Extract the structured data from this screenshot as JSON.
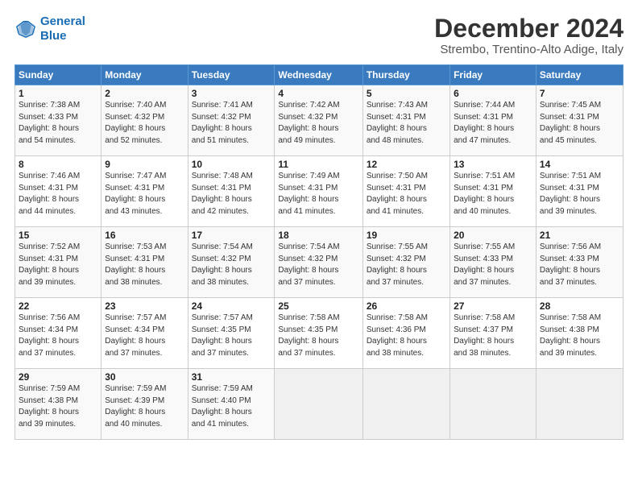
{
  "header": {
    "logo_line1": "General",
    "logo_line2": "Blue",
    "title": "December 2024",
    "subtitle": "Strembo, Trentino-Alto Adige, Italy"
  },
  "calendar": {
    "weekdays": [
      "Sunday",
      "Monday",
      "Tuesday",
      "Wednesday",
      "Thursday",
      "Friday",
      "Saturday"
    ],
    "weeks": [
      [
        {
          "day": "1",
          "info": "Sunrise: 7:38 AM\nSunset: 4:33 PM\nDaylight: 8 hours\nand 54 minutes."
        },
        {
          "day": "2",
          "info": "Sunrise: 7:40 AM\nSunset: 4:32 PM\nDaylight: 8 hours\nand 52 minutes."
        },
        {
          "day": "3",
          "info": "Sunrise: 7:41 AM\nSunset: 4:32 PM\nDaylight: 8 hours\nand 51 minutes."
        },
        {
          "day": "4",
          "info": "Sunrise: 7:42 AM\nSunset: 4:32 PM\nDaylight: 8 hours\nand 49 minutes."
        },
        {
          "day": "5",
          "info": "Sunrise: 7:43 AM\nSunset: 4:31 PM\nDaylight: 8 hours\nand 48 minutes."
        },
        {
          "day": "6",
          "info": "Sunrise: 7:44 AM\nSunset: 4:31 PM\nDaylight: 8 hours\nand 47 minutes."
        },
        {
          "day": "7",
          "info": "Sunrise: 7:45 AM\nSunset: 4:31 PM\nDaylight: 8 hours\nand 45 minutes."
        }
      ],
      [
        {
          "day": "8",
          "info": "Sunrise: 7:46 AM\nSunset: 4:31 PM\nDaylight: 8 hours\nand 44 minutes."
        },
        {
          "day": "9",
          "info": "Sunrise: 7:47 AM\nSunset: 4:31 PM\nDaylight: 8 hours\nand 43 minutes."
        },
        {
          "day": "10",
          "info": "Sunrise: 7:48 AM\nSunset: 4:31 PM\nDaylight: 8 hours\nand 42 minutes."
        },
        {
          "day": "11",
          "info": "Sunrise: 7:49 AM\nSunset: 4:31 PM\nDaylight: 8 hours\nand 41 minutes."
        },
        {
          "day": "12",
          "info": "Sunrise: 7:50 AM\nSunset: 4:31 PM\nDaylight: 8 hours\nand 41 minutes."
        },
        {
          "day": "13",
          "info": "Sunrise: 7:51 AM\nSunset: 4:31 PM\nDaylight: 8 hours\nand 40 minutes."
        },
        {
          "day": "14",
          "info": "Sunrise: 7:51 AM\nSunset: 4:31 PM\nDaylight: 8 hours\nand 39 minutes."
        }
      ],
      [
        {
          "day": "15",
          "info": "Sunrise: 7:52 AM\nSunset: 4:31 PM\nDaylight: 8 hours\nand 39 minutes."
        },
        {
          "day": "16",
          "info": "Sunrise: 7:53 AM\nSunset: 4:31 PM\nDaylight: 8 hours\nand 38 minutes."
        },
        {
          "day": "17",
          "info": "Sunrise: 7:54 AM\nSunset: 4:32 PM\nDaylight: 8 hours\nand 38 minutes."
        },
        {
          "day": "18",
          "info": "Sunrise: 7:54 AM\nSunset: 4:32 PM\nDaylight: 8 hours\nand 37 minutes."
        },
        {
          "day": "19",
          "info": "Sunrise: 7:55 AM\nSunset: 4:32 PM\nDaylight: 8 hours\nand 37 minutes."
        },
        {
          "day": "20",
          "info": "Sunrise: 7:55 AM\nSunset: 4:33 PM\nDaylight: 8 hours\nand 37 minutes."
        },
        {
          "day": "21",
          "info": "Sunrise: 7:56 AM\nSunset: 4:33 PM\nDaylight: 8 hours\nand 37 minutes."
        }
      ],
      [
        {
          "day": "22",
          "info": "Sunrise: 7:56 AM\nSunset: 4:34 PM\nDaylight: 8 hours\nand 37 minutes."
        },
        {
          "day": "23",
          "info": "Sunrise: 7:57 AM\nSunset: 4:34 PM\nDaylight: 8 hours\nand 37 minutes."
        },
        {
          "day": "24",
          "info": "Sunrise: 7:57 AM\nSunset: 4:35 PM\nDaylight: 8 hours\nand 37 minutes."
        },
        {
          "day": "25",
          "info": "Sunrise: 7:58 AM\nSunset: 4:35 PM\nDaylight: 8 hours\nand 37 minutes."
        },
        {
          "day": "26",
          "info": "Sunrise: 7:58 AM\nSunset: 4:36 PM\nDaylight: 8 hours\nand 38 minutes."
        },
        {
          "day": "27",
          "info": "Sunrise: 7:58 AM\nSunset: 4:37 PM\nDaylight: 8 hours\nand 38 minutes."
        },
        {
          "day": "28",
          "info": "Sunrise: 7:58 AM\nSunset: 4:38 PM\nDaylight: 8 hours\nand 39 minutes."
        }
      ],
      [
        {
          "day": "29",
          "info": "Sunrise: 7:59 AM\nSunset: 4:38 PM\nDaylight: 8 hours\nand 39 minutes."
        },
        {
          "day": "30",
          "info": "Sunrise: 7:59 AM\nSunset: 4:39 PM\nDaylight: 8 hours\nand 40 minutes."
        },
        {
          "day": "31",
          "info": "Sunrise: 7:59 AM\nSunset: 4:40 PM\nDaylight: 8 hours\nand 41 minutes."
        },
        {
          "day": "",
          "info": ""
        },
        {
          "day": "",
          "info": ""
        },
        {
          "day": "",
          "info": ""
        },
        {
          "day": "",
          "info": ""
        }
      ]
    ]
  }
}
